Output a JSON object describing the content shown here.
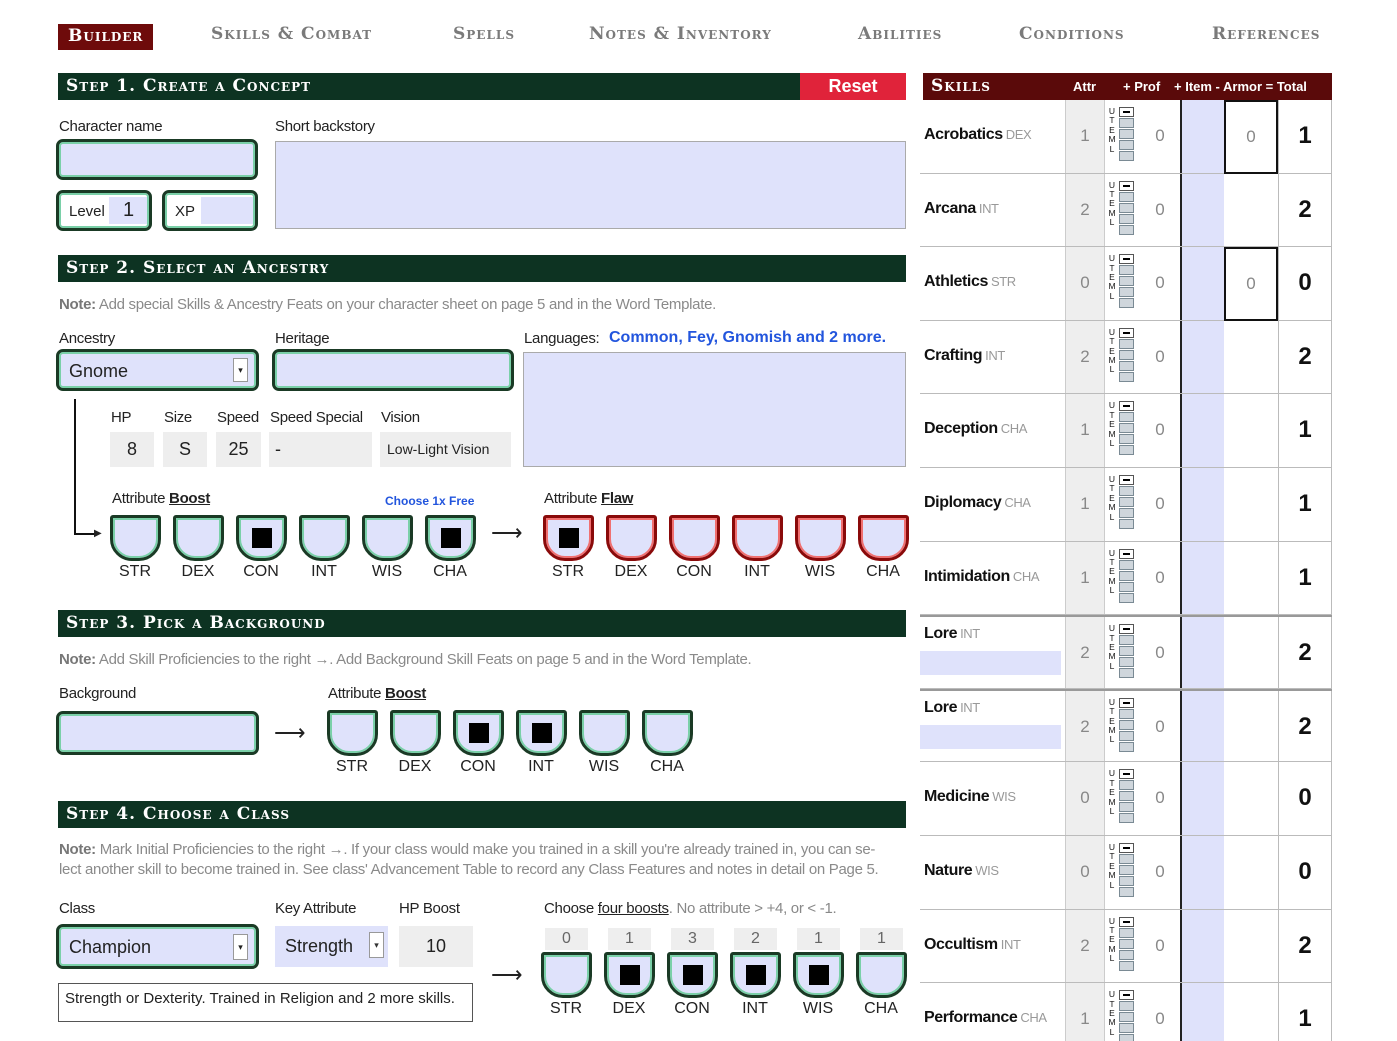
{
  "nav": {
    "tabs": [
      "Builder",
      "Skills & Combat",
      "Spells",
      "Notes & Inventory",
      "Abilities",
      "Conditions",
      "References"
    ],
    "active": "Builder"
  },
  "step1": {
    "title": "Step 1. Create a Concept",
    "reset": "Reset",
    "character_name_label": "Character name",
    "character_name": "",
    "backstory_label": "Short backstory",
    "backstory": "",
    "level_label": "Level",
    "level": "1",
    "xp_label": "XP",
    "xp": ""
  },
  "step2": {
    "title": "Step 2. Select an Ancestry",
    "note_bold": "Note:",
    "note": " Add special Skills & Ancestry Feats on your character sheet on page 5 and in the Word Template.",
    "ancestry_label": "Ancestry",
    "ancestry": "Gnome",
    "heritage_label": "Heritage",
    "heritage": "",
    "languages_label": "Languages:",
    "languages": "Common, Fey, Gnomish and 2 more.",
    "hp_label": "HP",
    "hp": "8",
    "size_label": "Size",
    "size": "S",
    "speed_label": "Speed",
    "speed": "25",
    "speed_special_label": "Speed Special",
    "speed_special": "-",
    "vision_label": "Vision",
    "vision": "Low-Light Vision",
    "boost_label": "Attribute ",
    "boost_word": "Boost",
    "choose_free": "Choose 1x Free",
    "flaw_label": "Attribute ",
    "flaw_word": "Flaw",
    "boosts": [
      false,
      false,
      true,
      false,
      false,
      true
    ],
    "flaws": [
      true,
      false,
      false,
      false,
      false,
      false
    ]
  },
  "attributes": [
    "STR",
    "DEX",
    "CON",
    "INT",
    "WIS",
    "CHA"
  ],
  "step3": {
    "title": "Step 3. Pick a Background",
    "note_bold": "Note:",
    "note": " Add Skill Proficiencies to the right →. Add Background Skill Feats on page 5 and in the Word Template.",
    "background_label": "Background",
    "background": "",
    "boost_label": "Attribute ",
    "boost_word": "Boost",
    "boosts": [
      false,
      false,
      true,
      true,
      false,
      false
    ]
  },
  "step4": {
    "title": "Step 4. Choose a Class",
    "note_bold": "Note:",
    "note_line1": " Mark Initial Proficiencies to the right →. If your class would make you trained in a skill you're already trained in, you can se-",
    "note_line2": "lect another skill to become trained in. See class' Advancement Table to record any Class Features and notes in detail on Page 5.",
    "class_label": "Class",
    "class": "Champion",
    "key_attr_label": "Key Attribute",
    "key_attr": "Strength",
    "hp_boost_label": "HP Boost",
    "hp_boost": "10",
    "class_desc": "Strength or Dexterity. Trained in Religion and 2 more skills.",
    "choose_pre": "Choose ",
    "choose_link": "four boosts",
    "choose_post": ". No attribute > +4, or < -1.",
    "totals": [
      "0",
      "1",
      "3",
      "2",
      "1",
      "1"
    ],
    "boosts": [
      false,
      true,
      true,
      true,
      true,
      false
    ]
  },
  "skills_panel": {
    "title": "Skills",
    "col_attr": "Attr",
    "col_prof": "+ Prof",
    "col_rest": "+ Item - Armor = Total",
    "prof_letters": [
      "U",
      "T",
      "E",
      "M",
      "L"
    ],
    "rows": [
      {
        "name": "Acrobatics",
        "attr": "DEX",
        "val": "1",
        "prof": "0",
        "armor": "0",
        "total": "1"
      },
      {
        "name": "Arcana",
        "attr": "INT",
        "val": "2",
        "prof": "0",
        "armor": "",
        "total": "2"
      },
      {
        "name": "Athletics",
        "attr": "STR",
        "val": "0",
        "prof": "0",
        "armor": "0",
        "total": "0"
      },
      {
        "name": "Crafting",
        "attr": "INT",
        "val": "2",
        "prof": "0",
        "armor": "",
        "total": "2"
      },
      {
        "name": "Deception",
        "attr": "CHA",
        "val": "1",
        "prof": "0",
        "armor": "",
        "total": "1"
      },
      {
        "name": "Diplomacy",
        "attr": "CHA",
        "val": "1",
        "prof": "0",
        "armor": "",
        "total": "1"
      },
      {
        "name": "Intimidation",
        "attr": "CHA",
        "val": "1",
        "prof": "0",
        "armor": "",
        "total": "1"
      },
      {
        "name": "Lore",
        "attr": "INT",
        "val": "2",
        "prof": "0",
        "armor": "",
        "total": "2",
        "lore": true
      },
      {
        "name": "Lore",
        "attr": "INT",
        "val": "2",
        "prof": "0",
        "armor": "",
        "total": "2",
        "lore": true
      },
      {
        "name": "Medicine",
        "attr": "WIS",
        "val": "0",
        "prof": "0",
        "armor": "",
        "total": "0"
      },
      {
        "name": "Nature",
        "attr": "WIS",
        "val": "0",
        "prof": "0",
        "armor": "",
        "total": "0"
      },
      {
        "name": "Occultism",
        "attr": "INT",
        "val": "2",
        "prof": "0",
        "armor": "",
        "total": "2"
      },
      {
        "name": "Performance",
        "attr": "CHA",
        "val": "1",
        "prof": "0",
        "armor": "",
        "total": "1"
      }
    ]
  },
  "colors": {
    "nav_active": "#6e0b0b",
    "step_bar": "#0d3322",
    "skills_bar": "#5a0a0a",
    "reset": "#e0233a",
    "input_fill": "#dfe2fb",
    "link_blue": "#2255dd"
  }
}
